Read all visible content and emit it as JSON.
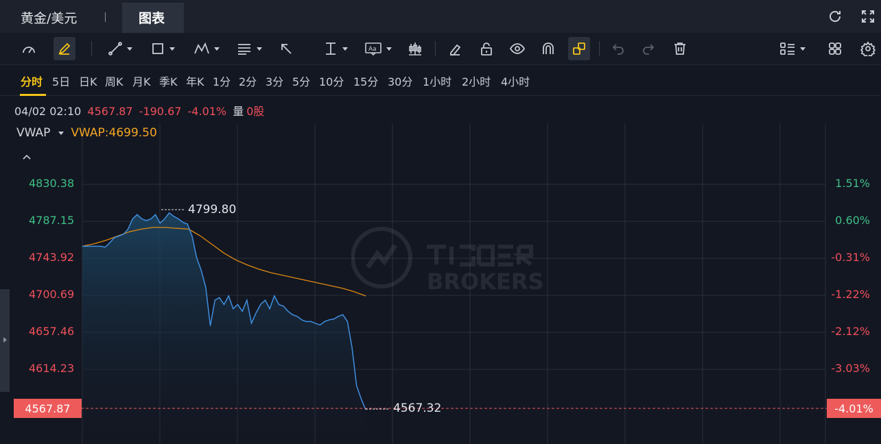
{
  "header": {
    "symbol_tab": "黄金/美元",
    "chart_tab": "图表",
    "icons": [
      "refresh-icon",
      "fullscreen-icon"
    ]
  },
  "toolbar": {
    "icons": [
      "gauge-icon",
      "pen-icon",
      "line-icon",
      "rectangle-icon",
      "pattern-icon",
      "fib-icon",
      "arrow-icon",
      "measure-icon",
      "text-icon",
      "indicator-icon",
      "eraser-icon",
      "unlock-icon",
      "eye-icon",
      "magnet-icon",
      "link-icon",
      "undo-icon",
      "redo-icon",
      "trash-icon",
      "layout-list-icon",
      "grid-icon",
      "settings-icon"
    ]
  },
  "periods": {
    "items": [
      "分时",
      "5日",
      "日K",
      "周K",
      "月K",
      "季K",
      "年K",
      "1分",
      "2分",
      "3分",
      "5分",
      "10分",
      "15分",
      "30分",
      "1小时",
      "2小时",
      "4小时"
    ],
    "active_index": 0
  },
  "info": {
    "time": "04/02 02:10",
    "price": "4567.87",
    "change": "-190.67",
    "change_pct": "-4.01%",
    "volume_label": "量",
    "volume": "0股"
  },
  "indicator": {
    "name": "VWAP",
    "value_text": "VWAP:4699.50"
  },
  "colors": {
    "price_line": "#3f8fe0",
    "vwap_line": "#e08a10",
    "up": "#3fbf86",
    "down": "#f0505a",
    "active_period": "#f5c518",
    "price_tag": "#ee5a5a"
  },
  "chart_data": {
    "type": "area",
    "y_left_ticks": [
      "4830.38",
      "4787.15",
      "4743.92",
      "4700.69",
      "4657.46",
      "4614.23"
    ],
    "y_right_ticks": [
      "1.51%",
      "0.60%",
      "-0.31%",
      "-1.22%",
      "-2.12%",
      "-3.03%"
    ],
    "current_price": "4567.87",
    "current_pct": "-4.01%",
    "high_label": "4799.80",
    "low_label": "4567.32",
    "series": [
      {
        "name": "VWAP",
        "values": [
          4758,
          4761,
          4765,
          4770,
          4775,
          4778,
          4780,
          4780,
          4779,
          4778,
          4770,
          4760,
          4750,
          4742,
          4736,
          4731,
          4727,
          4724,
          4721,
          4718,
          4715,
          4712,
          4709,
          4705,
          4700
        ]
      }
    ],
    "price": [
      4758,
      4758,
      4758,
      4758,
      4758,
      4757,
      4762,
      4768,
      4770,
      4772,
      4778,
      4790,
      4795,
      4790,
      4788,
      4790,
      4795,
      4785,
      4790,
      4797,
      4793,
      4790,
      4786,
      4784,
      4770,
      4745,
      4730,
      4710,
      4665,
      4695,
      4698,
      4690,
      4700,
      4685,
      4690,
      4682,
      4695,
      4668,
      4680,
      4690,
      4695,
      4685,
      4700,
      4690,
      4688,
      4682,
      4678,
      4676,
      4672,
      4670,
      4670,
      4668,
      4666,
      4670,
      4672,
      4673,
      4676,
      4678,
      4670,
      4640,
      4595,
      4580,
      4567
    ],
    "ylim": [
      4567,
      4860
    ]
  }
}
